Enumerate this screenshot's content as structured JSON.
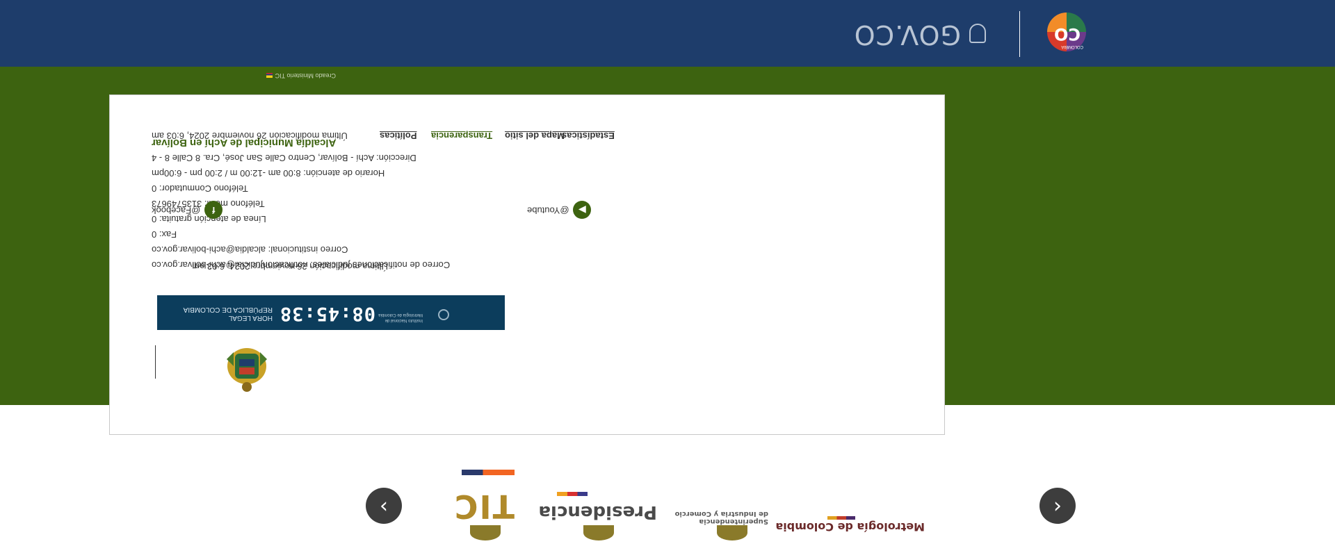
{
  "header": {
    "brand": "GOV.CO",
    "logo_text": "CO",
    "logo_sub": "COLOMBIA"
  },
  "credit": "Creado Ministerio TIC",
  "footer": {
    "title": "Alcaldía Municipal de Achí en Bolívar",
    "lines": [
      "Dirección: Achí - Bolívar, Centro Calle San José, Cra. 8 Calle 8 - 4",
      "Horario de atención: 8:00 am -12:00 m / 2:00 pm - 6:00pm",
      "Teléfono Conmutador: 0",
      "Teléfono móvil: 3135749673",
      "Línea de atención gratuita: 0",
      "Fax: 0",
      "Correo institucional: alcaldia@achi-bolivar.gov.co",
      "Correo de notificaciones judiciales: notificacionjudicial@achi-bolivar.gov.co"
    ],
    "clock": {
      "time": "08:45:38",
      "label_1": "HORA LEGAL",
      "label_2": "REPÚBLICA DE COLOMBIA",
      "inm_1": "Instituto Nacional de",
      "inm_2": "Metrología de Colombia"
    },
    "last_modified": "Última modificación 26 noviembre 2024, 6:03 am",
    "social": {
      "facebook": "@Facebook",
      "youtube": "@Youtube"
    },
    "bottom": {
      "last_modified": "Última modificación 26 noviembre 2024, 6:03 am",
      "links": [
        "Políticas",
        "Transparencia",
        "Mapa del sitio",
        "Estadísticas"
      ]
    }
  },
  "carousel": {
    "logos": [
      "Metrología de Colombia",
      "Industria y Comercio",
      "Presidencia",
      "TIC"
    ],
    "sic_line_1": "Superintendencia",
    "sic_line_2": "de Industria y Comercio",
    "prev_icon": "chevron-left-icon",
    "next_icon": "chevron-right-icon"
  },
  "colors": {
    "primary_green": "#3d6310",
    "gov_blue": "#1e3d6b",
    "clock_bg": "#0c3d5c"
  }
}
